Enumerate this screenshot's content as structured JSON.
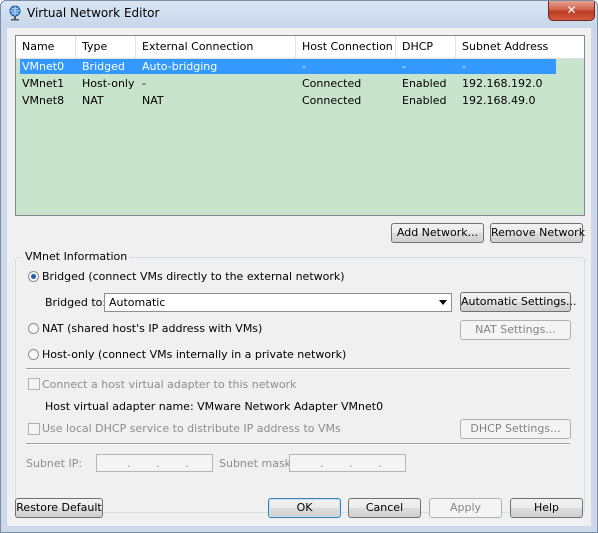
{
  "window": {
    "title": "Virtual Network Editor",
    "close_glyph": "✕"
  },
  "table": {
    "columns": [
      "Name",
      "Type",
      "External Connection",
      "Host Connection",
      "DHCP",
      "Subnet Address"
    ],
    "rows": [
      [
        "VMnet0",
        "Bridged",
        "Auto-bridging",
        "-",
        "-",
        "-"
      ],
      [
        "VMnet1",
        "Host-only",
        "-",
        "Connected",
        "Enabled",
        "192.168.192.0"
      ],
      [
        "VMnet8",
        "NAT",
        "NAT",
        "Connected",
        "Enabled",
        "192.168.49.0"
      ]
    ]
  },
  "buttons": {
    "add_network": "Add Network...",
    "remove_network": "Remove Network",
    "automatic_settings": "Automatic Settings...",
    "nat_settings": "NAT Settings...",
    "dhcp_settings": "DHCP Settings...",
    "restore_default": "Restore Default",
    "ok": "OK",
    "cancel": "Cancel",
    "apply": "Apply",
    "help": "Help"
  },
  "vmnet_info": {
    "group_label": "VMnet Information",
    "bridged_option": "Bridged (connect VMs directly to the external network)",
    "bridged_to_label": "Bridged to:",
    "bridged_to_value": "Automatic",
    "nat_option": "NAT (shared host's IP address with VMs)",
    "hostonly_option": "Host-only (connect VMs internally in a private network)",
    "connect_adapter": "Connect a host virtual adapter to this network",
    "adapter_name": "Host virtual adapter name: VMware Network Adapter VMnet0",
    "use_dhcp": "Use local DHCP service to distribute IP address to VMs",
    "subnet_ip_label": "Subnet IP:",
    "subnet_mask_label": "Subnet mask:"
  },
  "colors": {
    "table_background": "#c8e4cc",
    "selection": "#3399ff",
    "radio_dot": "#1f5fb0"
  }
}
